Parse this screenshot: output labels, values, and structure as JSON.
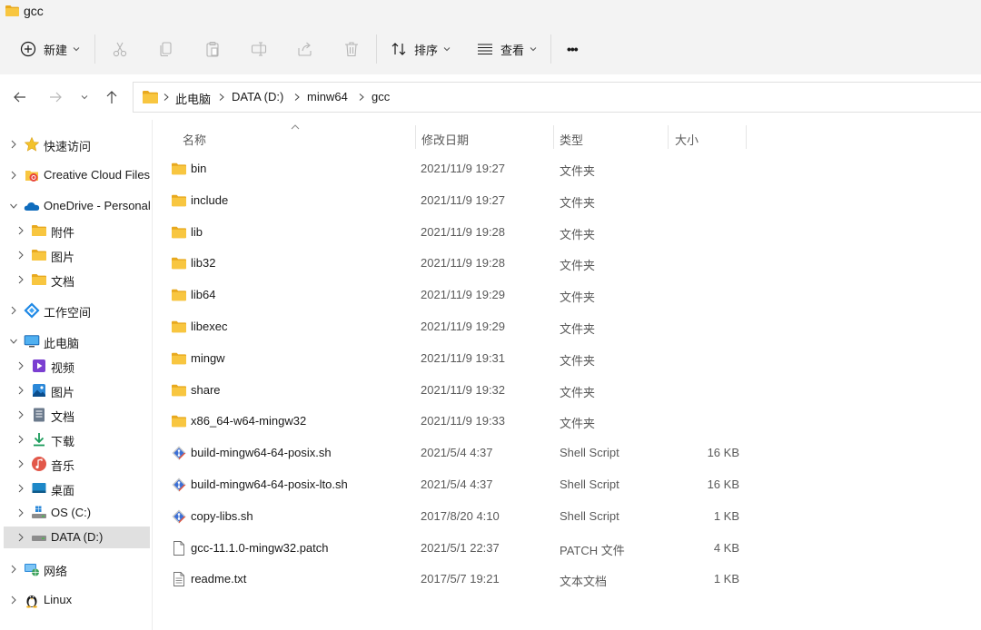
{
  "window": {
    "title": "gcc"
  },
  "toolbar": {
    "new_label": "新建",
    "sort_label": "排序",
    "view_label": "查看",
    "more_label": "•••"
  },
  "address": {
    "crumbs": [
      "此电脑",
      "DATA (D:)",
      "minw64",
      "gcc"
    ]
  },
  "sidebar": {
    "items": [
      {
        "label": "快速访问",
        "icon": "star-icon"
      },
      {
        "label": "Creative Cloud Files",
        "icon": "creative-cloud-icon"
      },
      {
        "label": "OneDrive - Personal",
        "icon": "onedrive-cloud-icon"
      },
      {
        "label": "附件",
        "icon": "folder-icon"
      },
      {
        "label": "图片",
        "icon": "folder-icon"
      },
      {
        "label": "文档",
        "icon": "folder-icon"
      },
      {
        "label": "工作空间",
        "icon": "workspace-icon"
      },
      {
        "label": "此电脑",
        "icon": "monitor-icon"
      },
      {
        "label": "视频",
        "icon": "video-icon"
      },
      {
        "label": "图片",
        "icon": "pictures-icon"
      },
      {
        "label": "文档",
        "icon": "documents-icon"
      },
      {
        "label": "下载",
        "icon": "download-icon"
      },
      {
        "label": "音乐",
        "icon": "music-icon"
      },
      {
        "label": "桌面",
        "icon": "desktop-icon"
      },
      {
        "label": "OS (C:)",
        "icon": "drive-c-icon"
      },
      {
        "label": "DATA (D:)",
        "icon": "drive-icon"
      },
      {
        "label": "网络",
        "icon": "network-icon"
      },
      {
        "label": "Linux",
        "icon": "linux-penguin-icon"
      }
    ]
  },
  "columns": {
    "name": "名称",
    "date": "修改日期",
    "type": "类型",
    "size": "大小"
  },
  "files": [
    {
      "name": "bin",
      "date": "2021/11/9 19:27",
      "type": "文件夹",
      "size": "",
      "icon": "folder-icon"
    },
    {
      "name": "include",
      "date": "2021/11/9 19:27",
      "type": "文件夹",
      "size": "",
      "icon": "folder-icon"
    },
    {
      "name": "lib",
      "date": "2021/11/9 19:28",
      "type": "文件夹",
      "size": "",
      "icon": "folder-icon"
    },
    {
      "name": "lib32",
      "date": "2021/11/9 19:28",
      "type": "文件夹",
      "size": "",
      "icon": "folder-icon"
    },
    {
      "name": "lib64",
      "date": "2021/11/9 19:29",
      "type": "文件夹",
      "size": "",
      "icon": "folder-icon"
    },
    {
      "name": "libexec",
      "date": "2021/11/9 19:29",
      "type": "文件夹",
      "size": "",
      "icon": "folder-icon"
    },
    {
      "name": "mingw",
      "date": "2021/11/9 19:31",
      "type": "文件夹",
      "size": "",
      "icon": "folder-icon"
    },
    {
      "name": "share",
      "date": "2021/11/9 19:32",
      "type": "文件夹",
      "size": "",
      "icon": "folder-icon"
    },
    {
      "name": "x86_64-w64-mingw32",
      "date": "2021/11/9 19:33",
      "type": "文件夹",
      "size": "",
      "icon": "folder-icon"
    },
    {
      "name": "build-mingw64-64-posix.sh",
      "date": "2021/5/4 4:37",
      "type": "Shell Script",
      "size": "16 KB",
      "icon": "git-script-icon"
    },
    {
      "name": "build-mingw64-64-posix-lto.sh",
      "date": "2021/5/4 4:37",
      "type": "Shell Script",
      "size": "16 KB",
      "icon": "git-script-icon"
    },
    {
      "name": "copy-libs.sh",
      "date": "2017/8/20 4:10",
      "type": "Shell Script",
      "size": "1 KB",
      "icon": "git-script-icon"
    },
    {
      "name": "gcc-11.1.0-mingw32.patch",
      "date": "2021/5/1 22:37",
      "type": "PATCH 文件",
      "size": "4 KB",
      "icon": "blank-file-icon"
    },
    {
      "name": "readme.txt",
      "date": "2017/5/7 19:21",
      "type": "文本文档",
      "size": "1 KB",
      "icon": "text-file-icon"
    }
  ],
  "colors": {
    "folder": "#f8c640",
    "folder_dark": "#e8a91f",
    "selected": "#e0e0e0",
    "chrome": "#f3f3f3"
  }
}
